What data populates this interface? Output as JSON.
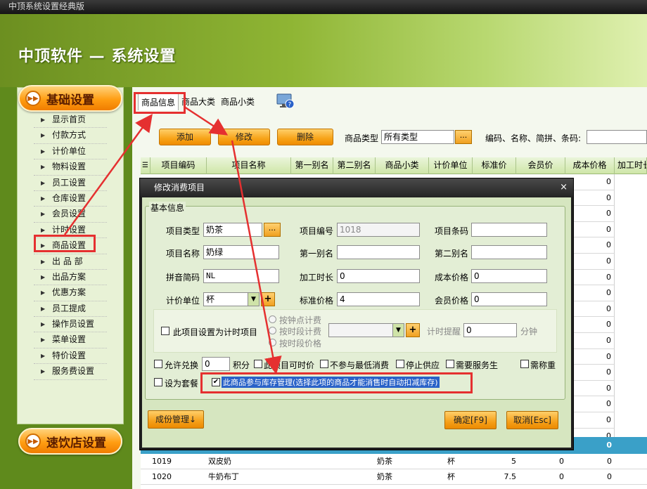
{
  "window": {
    "title": "中顶系统设置经典版"
  },
  "app": {
    "title": "中顶软件 — 系统设置"
  },
  "sidebar": {
    "basic_label": "基础设置",
    "fast_label": "速饮店设置",
    "items": [
      "显示首页",
      "付款方式",
      "计价单位",
      "物料设置",
      "员工设置",
      "仓库设置",
      "会员设置",
      "计时设置",
      "商品设置",
      "出 品 部",
      "出品方案",
      "优惠方案",
      "员工提成",
      "操作员设置",
      "菜单设置",
      "特价设置",
      "服务费设置"
    ]
  },
  "tabs": [
    "商品信息",
    "商品大类",
    "商品小类"
  ],
  "toolbar": {
    "add": "添加",
    "edit": "修改",
    "delete": "删除",
    "type_label": "商品类型",
    "type_value": "所有类型",
    "dots": "...",
    "search_label": "编码、名称、简拼、条码:"
  },
  "grid": {
    "headers": [
      "项目编码",
      "项目名称",
      "第一别名",
      "第二别名",
      "商品小类",
      "计价单位",
      "标准价",
      "会员价",
      "成本价格",
      "加工时长"
    ],
    "cost_values": [
      "0",
      "0",
      "0",
      "0",
      "0",
      "0",
      "0",
      "0",
      "0",
      "0",
      "0",
      "0",
      "0",
      "0",
      "0",
      "0",
      "0"
    ],
    "selected_cost": "0",
    "rows": [
      {
        "code": "1019",
        "name": "双皮奶",
        "cat": "奶茶",
        "unit": "杯",
        "price": "5",
        "member": "0",
        "cost": "0"
      },
      {
        "code": "1020",
        "name": "牛奶布丁",
        "cat": "奶茶",
        "unit": "杯",
        "price": "7.5",
        "member": "0",
        "cost": "0"
      }
    ]
  },
  "dialog": {
    "title": "修改消费项目",
    "close": "×",
    "group": "基本信息",
    "fields": {
      "type_label": "项目类型",
      "type_value": "奶茶",
      "code_label": "项目编号",
      "code_value": "1018",
      "barcode_label": "项目条码",
      "barcode_value": "",
      "name_label": "项目名称",
      "name_value": "奶绿",
      "alias1_label": "第一别名",
      "alias1_value": "",
      "alias2_label": "第二别名",
      "alias2_value": "",
      "pinyin_label": "拼音简码",
      "pinyin_value": "NL",
      "process_label": "加工时长",
      "process_value": "0",
      "cost_label": "成本价格",
      "cost_value": "0",
      "unit_label": "计价单位",
      "unit_value": "杯",
      "price_label": "标准价格",
      "price_value": "4",
      "member_label": "会员价格",
      "member_value": "0"
    },
    "timer": {
      "check_label": "此项目设置为计时项目",
      "radio1": "按钟点计费",
      "radio2": "按时段计费",
      "radio3": "按时段价格",
      "remind_label": "计时提醒",
      "remind_value": "0",
      "minute_label": "分钟"
    },
    "options": {
      "exchange": "允许兑换",
      "exchange_value": "0",
      "points": "积分",
      "anytime": "此项目可时价",
      "nomin": "不参与最低消费",
      "stop": "停止供应",
      "service": "需要服务生",
      "weigh": "需称重",
      "combo": "设为套餐",
      "inventory": "此商品参与库存管理(选择此项的商品才能消售时自动扣减库存)"
    },
    "buttons": {
      "component": "成份管理↓",
      "ok": "确定[F9]",
      "cancel": "取消[Esc]"
    }
  },
  "colors": {
    "accent_orange": "#f7a318",
    "header_green": "#8fb534",
    "annotation_red": "#e53030",
    "selected_row": "#3aa0c8"
  },
  "icons": [
    "help-monitor-icon",
    "arrow-right-icon",
    "dropdown-icon",
    "plus-icon",
    "checkmark-icon"
  ]
}
